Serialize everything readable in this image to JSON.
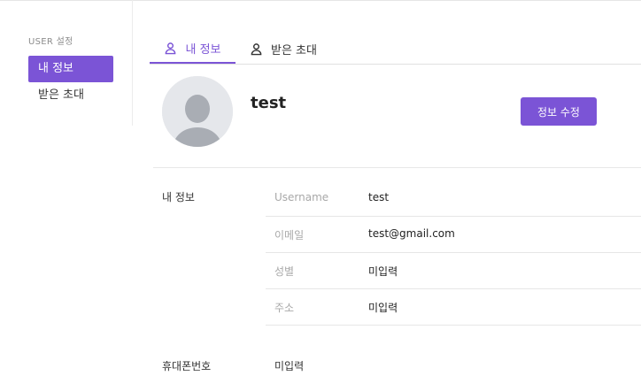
{
  "sidebar": {
    "heading": "USER 설정",
    "items": [
      {
        "label": "내 정보",
        "active": true
      },
      {
        "label": "받은 초대",
        "active": false
      }
    ]
  },
  "tabs": [
    {
      "label": "내 정보",
      "icon": "user-icon",
      "active": true
    },
    {
      "label": "받은 초대",
      "icon": "user-icon",
      "active": false
    }
  ],
  "profile": {
    "name": "test",
    "edit_label": "정보 수정"
  },
  "info": {
    "section_title": "내 정보",
    "rows": [
      {
        "key": "Username",
        "value": "test"
      },
      {
        "key": "이메일",
        "value": "test@gmail.com"
      },
      {
        "key": "성별",
        "value": "미입력"
      },
      {
        "key": "주소",
        "value": "미입력"
      }
    ]
  },
  "phone": {
    "label": "휴대폰번호",
    "value": "미입력"
  },
  "colors": {
    "accent": "#7b54d6",
    "avatar_bg": "#e5e7eb",
    "avatar_fg": "#a9adb4"
  }
}
